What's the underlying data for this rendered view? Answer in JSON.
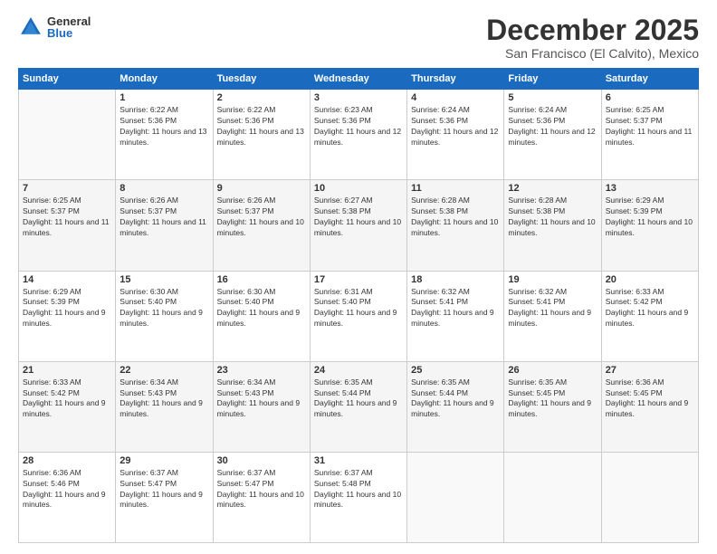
{
  "logo": {
    "general": "General",
    "blue": "Blue"
  },
  "title": "December 2025",
  "subtitle": "San Francisco (El Calvito), Mexico",
  "days_header": [
    "Sunday",
    "Monday",
    "Tuesday",
    "Wednesday",
    "Thursday",
    "Friday",
    "Saturday"
  ],
  "weeks": [
    [
      {
        "day": "",
        "sunrise": "",
        "sunset": "",
        "daylight": ""
      },
      {
        "day": "1",
        "sunrise": "Sunrise: 6:22 AM",
        "sunset": "Sunset: 5:36 PM",
        "daylight": "Daylight: 11 hours and 13 minutes."
      },
      {
        "day": "2",
        "sunrise": "Sunrise: 6:22 AM",
        "sunset": "Sunset: 5:36 PM",
        "daylight": "Daylight: 11 hours and 13 minutes."
      },
      {
        "day": "3",
        "sunrise": "Sunrise: 6:23 AM",
        "sunset": "Sunset: 5:36 PM",
        "daylight": "Daylight: 11 hours and 12 minutes."
      },
      {
        "day": "4",
        "sunrise": "Sunrise: 6:24 AM",
        "sunset": "Sunset: 5:36 PM",
        "daylight": "Daylight: 11 hours and 12 minutes."
      },
      {
        "day": "5",
        "sunrise": "Sunrise: 6:24 AM",
        "sunset": "Sunset: 5:36 PM",
        "daylight": "Daylight: 11 hours and 12 minutes."
      },
      {
        "day": "6",
        "sunrise": "Sunrise: 6:25 AM",
        "sunset": "Sunset: 5:37 PM",
        "daylight": "Daylight: 11 hours and 11 minutes."
      }
    ],
    [
      {
        "day": "7",
        "sunrise": "Sunrise: 6:25 AM",
        "sunset": "Sunset: 5:37 PM",
        "daylight": "Daylight: 11 hours and 11 minutes."
      },
      {
        "day": "8",
        "sunrise": "Sunrise: 6:26 AM",
        "sunset": "Sunset: 5:37 PM",
        "daylight": "Daylight: 11 hours and 11 minutes."
      },
      {
        "day": "9",
        "sunrise": "Sunrise: 6:26 AM",
        "sunset": "Sunset: 5:37 PM",
        "daylight": "Daylight: 11 hours and 10 minutes."
      },
      {
        "day": "10",
        "sunrise": "Sunrise: 6:27 AM",
        "sunset": "Sunset: 5:38 PM",
        "daylight": "Daylight: 11 hours and 10 minutes."
      },
      {
        "day": "11",
        "sunrise": "Sunrise: 6:28 AM",
        "sunset": "Sunset: 5:38 PM",
        "daylight": "Daylight: 11 hours and 10 minutes."
      },
      {
        "day": "12",
        "sunrise": "Sunrise: 6:28 AM",
        "sunset": "Sunset: 5:38 PM",
        "daylight": "Daylight: 11 hours and 10 minutes."
      },
      {
        "day": "13",
        "sunrise": "Sunrise: 6:29 AM",
        "sunset": "Sunset: 5:39 PM",
        "daylight": "Daylight: 11 hours and 10 minutes."
      }
    ],
    [
      {
        "day": "14",
        "sunrise": "Sunrise: 6:29 AM",
        "sunset": "Sunset: 5:39 PM",
        "daylight": "Daylight: 11 hours and 9 minutes."
      },
      {
        "day": "15",
        "sunrise": "Sunrise: 6:30 AM",
        "sunset": "Sunset: 5:40 PM",
        "daylight": "Daylight: 11 hours and 9 minutes."
      },
      {
        "day": "16",
        "sunrise": "Sunrise: 6:30 AM",
        "sunset": "Sunset: 5:40 PM",
        "daylight": "Daylight: 11 hours and 9 minutes."
      },
      {
        "day": "17",
        "sunrise": "Sunrise: 6:31 AM",
        "sunset": "Sunset: 5:40 PM",
        "daylight": "Daylight: 11 hours and 9 minutes."
      },
      {
        "day": "18",
        "sunrise": "Sunrise: 6:32 AM",
        "sunset": "Sunset: 5:41 PM",
        "daylight": "Daylight: 11 hours and 9 minutes."
      },
      {
        "day": "19",
        "sunrise": "Sunrise: 6:32 AM",
        "sunset": "Sunset: 5:41 PM",
        "daylight": "Daylight: 11 hours and 9 minutes."
      },
      {
        "day": "20",
        "sunrise": "Sunrise: 6:33 AM",
        "sunset": "Sunset: 5:42 PM",
        "daylight": "Daylight: 11 hours and 9 minutes."
      }
    ],
    [
      {
        "day": "21",
        "sunrise": "Sunrise: 6:33 AM",
        "sunset": "Sunset: 5:42 PM",
        "daylight": "Daylight: 11 hours and 9 minutes."
      },
      {
        "day": "22",
        "sunrise": "Sunrise: 6:34 AM",
        "sunset": "Sunset: 5:43 PM",
        "daylight": "Daylight: 11 hours and 9 minutes."
      },
      {
        "day": "23",
        "sunrise": "Sunrise: 6:34 AM",
        "sunset": "Sunset: 5:43 PM",
        "daylight": "Daylight: 11 hours and 9 minutes."
      },
      {
        "day": "24",
        "sunrise": "Sunrise: 6:35 AM",
        "sunset": "Sunset: 5:44 PM",
        "daylight": "Daylight: 11 hours and 9 minutes."
      },
      {
        "day": "25",
        "sunrise": "Sunrise: 6:35 AM",
        "sunset": "Sunset: 5:44 PM",
        "daylight": "Daylight: 11 hours and 9 minutes."
      },
      {
        "day": "26",
        "sunrise": "Sunrise: 6:35 AM",
        "sunset": "Sunset: 5:45 PM",
        "daylight": "Daylight: 11 hours and 9 minutes."
      },
      {
        "day": "27",
        "sunrise": "Sunrise: 6:36 AM",
        "sunset": "Sunset: 5:45 PM",
        "daylight": "Daylight: 11 hours and 9 minutes."
      }
    ],
    [
      {
        "day": "28",
        "sunrise": "Sunrise: 6:36 AM",
        "sunset": "Sunset: 5:46 PM",
        "daylight": "Daylight: 11 hours and 9 minutes."
      },
      {
        "day": "29",
        "sunrise": "Sunrise: 6:37 AM",
        "sunset": "Sunset: 5:47 PM",
        "daylight": "Daylight: 11 hours and 9 minutes."
      },
      {
        "day": "30",
        "sunrise": "Sunrise: 6:37 AM",
        "sunset": "Sunset: 5:47 PM",
        "daylight": "Daylight: 11 hours and 10 minutes."
      },
      {
        "day": "31",
        "sunrise": "Sunrise: 6:37 AM",
        "sunset": "Sunset: 5:48 PM",
        "daylight": "Daylight: 11 hours and 10 minutes."
      },
      {
        "day": "",
        "sunrise": "",
        "sunset": "",
        "daylight": ""
      },
      {
        "day": "",
        "sunrise": "",
        "sunset": "",
        "daylight": ""
      },
      {
        "day": "",
        "sunrise": "",
        "sunset": "",
        "daylight": ""
      }
    ]
  ]
}
